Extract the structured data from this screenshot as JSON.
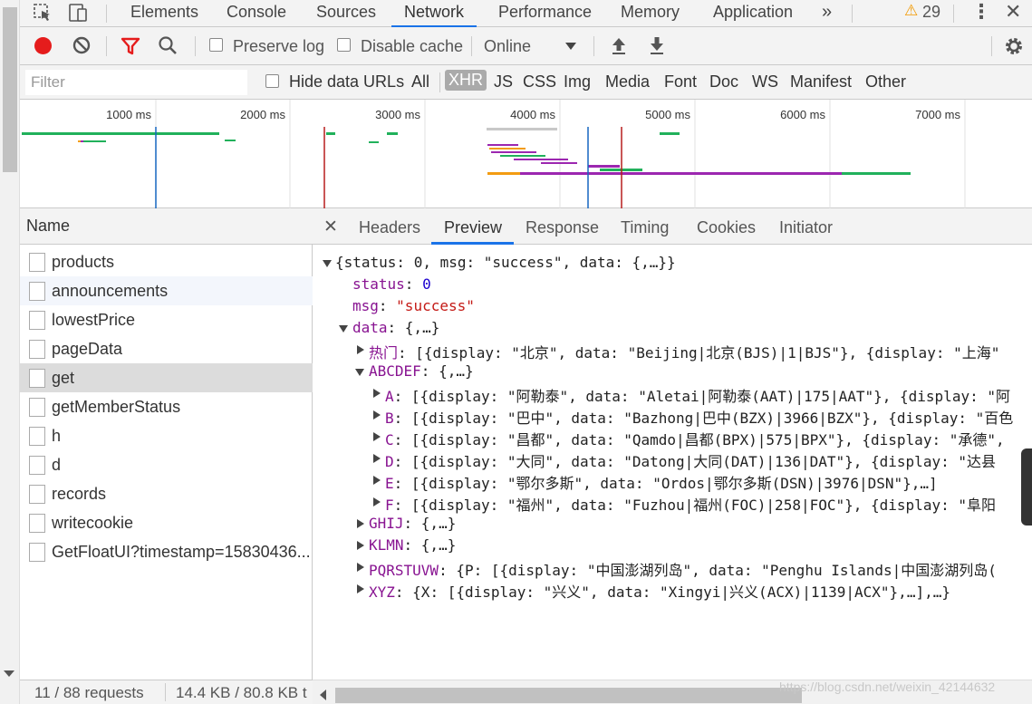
{
  "tabs": [
    {
      "label": "Elements",
      "active": false
    },
    {
      "label": "Console",
      "active": false
    },
    {
      "label": "Sources",
      "active": false
    },
    {
      "label": "Network",
      "active": true
    },
    {
      "label": "Performance",
      "active": false
    },
    {
      "label": "Memory",
      "active": false
    },
    {
      "label": "Application",
      "active": false
    }
  ],
  "more_tabs": "»",
  "warnings_count": "29",
  "toolbar": {
    "preserve_log": "Preserve log",
    "disable_cache": "Disable cache",
    "throttling": "Online"
  },
  "filter": {
    "placeholder": "Filter",
    "hide_data_urls": "Hide data URLs",
    "types": [
      "All",
      "XHR",
      "JS",
      "CSS",
      "Img",
      "Media",
      "Font",
      "Doc",
      "WS",
      "Manifest",
      "Other"
    ],
    "selected_type": "XHR"
  },
  "timeline": {
    "ticks": [
      "1000 ms",
      "2000 ms",
      "3000 ms",
      "4000 ms",
      "5000 ms",
      "6000 ms",
      "7000 ms"
    ],
    "colors": {
      "green": "#21b15b",
      "purple": "#9c27b0",
      "orange": "#f39c12",
      "blue": "#1565c0",
      "red": "#b71c1c"
    }
  },
  "name_column": "Name",
  "requests": [
    {
      "name": "products",
      "state": ""
    },
    {
      "name": "announcements",
      "state": "hover"
    },
    {
      "name": "lowestPrice",
      "state": ""
    },
    {
      "name": "pageData",
      "state": ""
    },
    {
      "name": "get",
      "state": "selected"
    },
    {
      "name": "getMemberStatus",
      "state": ""
    },
    {
      "name": "h",
      "state": ""
    },
    {
      "name": "d",
      "state": ""
    },
    {
      "name": "records",
      "state": ""
    },
    {
      "name": "writecookie",
      "state": ""
    },
    {
      "name": "GetFloatUI?timestamp=15830436...",
      "state": ""
    }
  ],
  "detail_tabs": [
    {
      "label": "Headers",
      "active": false
    },
    {
      "label": "Preview",
      "active": true
    },
    {
      "label": "Response",
      "active": false
    },
    {
      "label": "Timing",
      "active": false
    },
    {
      "label": "Cookies",
      "active": false
    },
    {
      "label": "Initiator",
      "active": false
    }
  ],
  "preview": {
    "root": "{status: 0, msg: \"success\", data: {,…}}",
    "status_key": "status",
    "status_val": "0",
    "msg_key": "msg",
    "msg_val": "\"success\"",
    "data_key": "data",
    "data_val": "{,…}",
    "remen_key": "热门",
    "remen_val": "[{display: \"北京\", data: \"Beijing|北京(BJS)|1|BJS\"}, {display: \"上海\"",
    "abcdef_key": "ABCDEF",
    "abcdef_val": "{,…}",
    "a_key": "A",
    "a_val": "[{display: \"阿勒泰\", data: \"Aletai|阿勒泰(AAT)|175|AAT\"}, {display: \"阿",
    "b_key": "B",
    "b_val": "[{display: \"巴中\", data: \"Bazhong|巴中(BZX)|3966|BZX\"}, {display: \"百色",
    "c_key": "C",
    "c_val": "[{display: \"昌都\", data: \"Qamdo|昌都(BPX)|575|BPX\"}, {display: \"承德\",",
    "d_key": "D",
    "d_val": "[{display: \"大同\", data: \"Datong|大同(DAT)|136|DAT\"}, {display: \"达县",
    "e_key": "E",
    "e_val": "[{display: \"鄂尔多斯\", data: \"Ordos|鄂尔多斯(DSN)|3976|DSN\"},…]",
    "f_key": "F",
    "f_val": "[{display: \"福州\", data: \"Fuzhou|福州(FOC)|258|FOC\"}, {display: \"阜阳",
    "ghij_key": "GHIJ",
    "ghij_val": "{,…}",
    "klmn_key": "KLMN",
    "klmn_val": "{,…}",
    "pq_key": "PQRSTUVW",
    "pq_val": "{P: [{display: \"中国澎湖列岛\", data: \"Penghu Islands|中国澎湖列岛(",
    "xyz_key": "XYZ",
    "xyz_val": "{X: [{display: \"兴义\", data: \"Xingyi|兴义(ACX)|1139|ACX\"},…],…}"
  },
  "status_bar": {
    "requests": "11 / 88 requests",
    "transferred": "14.4 KB / 80.8 KB t"
  },
  "watermark": "https://blog.csdn.net/weixin_42144632"
}
